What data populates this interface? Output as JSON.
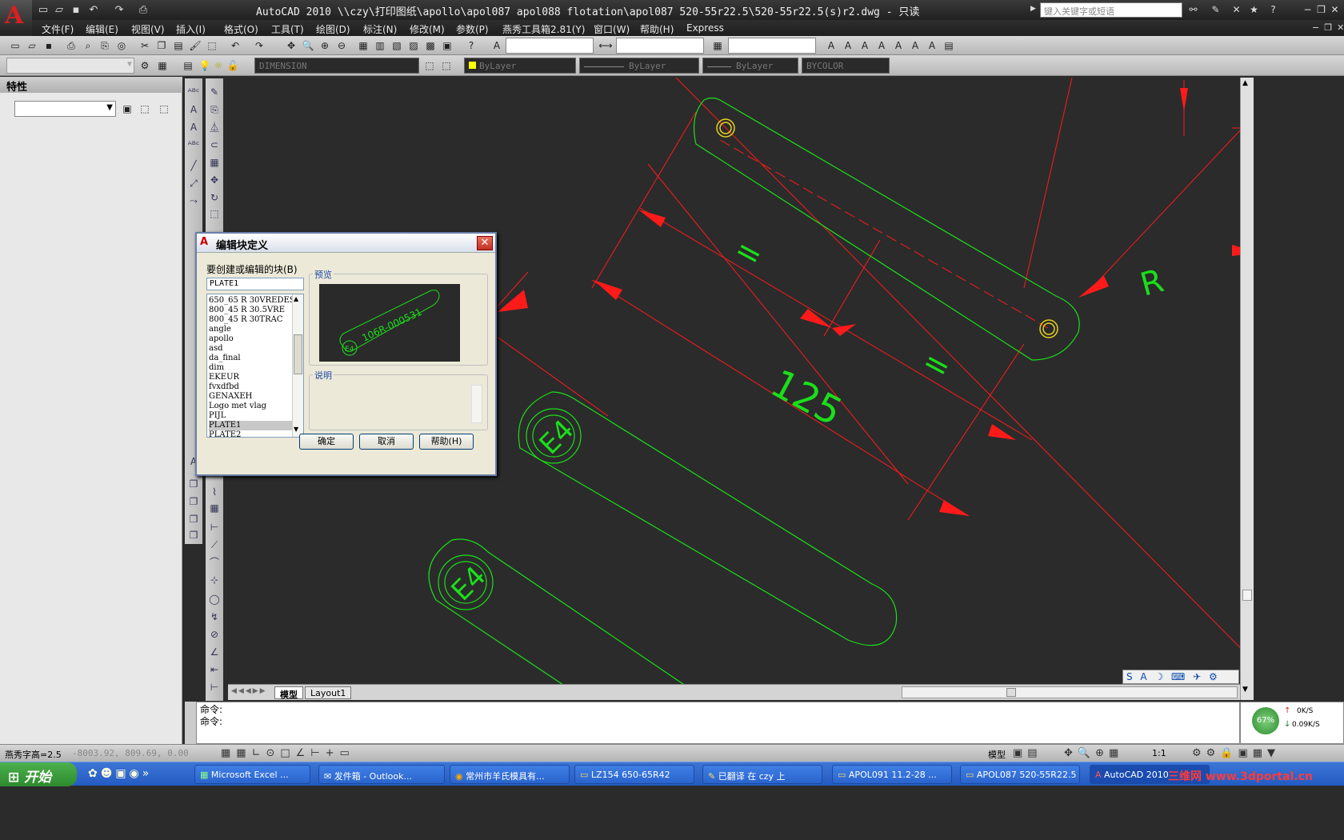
{
  "window": {
    "title": "AutoCAD 2010  \\\\czy\\打印图纸\\apollo\\apol087 apol088 flotation\\apol087 520-55r22.5\\520-55r22.5(s)r2.dwg - 只读",
    "search_placeholder": "键入关键字或短语"
  },
  "menu": [
    "文件(F)",
    "编辑(E)",
    "视图(V)",
    "插入(I)",
    "格式(O)",
    "工具(T)",
    "绘图(D)",
    "标注(N)",
    "修改(M)",
    "参数(P)",
    "燕秀工具箱2.81(Y)",
    "窗口(W)",
    "帮助(H)",
    "Express"
  ],
  "layers": {
    "dim_style": "DIMENSION",
    "color": "ByLayer",
    "linetype": "ByLayer",
    "lineweight": "ByLayer",
    "plotstyle": "BYCOLOR"
  },
  "properties": {
    "title": "特性"
  },
  "dialog": {
    "title": "编辑块定义",
    "block_label": "要创建或编辑的块(B)",
    "block_value": "PLATE1",
    "preview_label": "预览",
    "description_label": "说明",
    "preview_text": "106R-000531",
    "preview_badge": "E4",
    "ok": "确定",
    "cancel": "取消",
    "help": "帮助(H)",
    "blocks": [
      "650_65 R 30VREDES",
      "800_45 R 30.5VRE",
      "800_45 R 30TRAC",
      "angle",
      "apollo",
      "asd",
      "da_final",
      "dim",
      "EKEUR",
      "fvxdfbd",
      "GENAXEH",
      "Logo met vlag",
      "PIJL",
      "PLATE1",
      "PLATE2"
    ],
    "selected": "PLATE1"
  },
  "drawing": {
    "dim_125": "125",
    "dim_eq": "=",
    "dim_4": "4",
    "dim_r": "R",
    "badge": "E4"
  },
  "tabs": {
    "model": "模型",
    "layout": "Layout1"
  },
  "command": {
    "line1": "命令:",
    "line2": "命令:"
  },
  "status": {
    "left": "燕秀字高=2.5",
    "coords": "-8003.92, 809.69, 0.00",
    "model": "模型",
    "scale": "1:1"
  },
  "net": {
    "percent": "67%",
    "up": "0K/S",
    "down": "0.09K/S"
  },
  "taskbar": {
    "start": "开始",
    "tasks": [
      "Microsoft Excel ...",
      "发件箱 - Outlook...",
      "常州市羊氏模具有...",
      "LZ154 650-65R42",
      "已翻译 在 czy 上",
      "APOL091 11.2-28 ...",
      "APOL087 520-55R22.5",
      "AutoCAD 2010"
    ],
    "watermark": "三维网 www.3dportal.cn"
  }
}
